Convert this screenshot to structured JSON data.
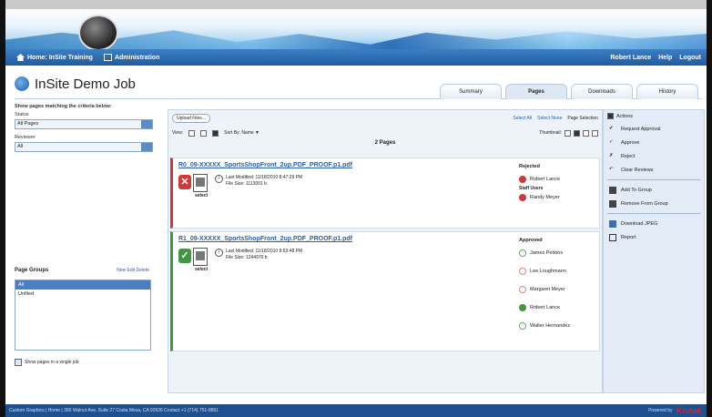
{
  "navbar": {
    "home": "Home: InSite Training",
    "admin": "Administration",
    "user_links": [
      "Robert Lance",
      "Help",
      "Logout"
    ]
  },
  "job": {
    "title": "InSite Demo Job"
  },
  "tabs": [
    {
      "label": "Summary",
      "active": false
    },
    {
      "label": "Pages",
      "active": true
    },
    {
      "label": "Downloads",
      "active": false
    },
    {
      "label": "History",
      "active": false
    }
  ],
  "filter": {
    "heading": "Show pages matching the criteria below:",
    "status_label": "Status",
    "status_value": "All Pages",
    "reviewer_label": "Reviewer",
    "reviewer_value": "All"
  },
  "page_groups": {
    "title": "Page Groups",
    "links": "New Edit Delete",
    "items": [
      {
        "label": "All",
        "selected": true
      },
      {
        "label": "Unfiled",
        "selected": false
      }
    ],
    "show_single": "Show pages in a single job"
  },
  "toolbar": {
    "upload": "Upload Files...",
    "select_all": "Select All",
    "select_none": "Select None",
    "page_selection": "Page Selection",
    "view_label": "View:",
    "sort_label": "Sort By: Name ▼",
    "thumbnail_label": "Thumbnail:"
  },
  "count": "2 Pages",
  "pages": [
    {
      "filename": "R0_09-XXXXX_SportsShopFront_2up.PDF_PROOF.p1.pdf",
      "status": "rejected",
      "status_glyph": "✕",
      "selected_label": "select",
      "last_modified": "Last Modified: 11/18/2010 8:47:29 PM",
      "file_size": "File Size: 1113001 b",
      "status_heading": "Rejected",
      "reviewers": [
        {
          "name": "Robert Lance",
          "state": "rejected"
        },
        {
          "group": "Staff Users"
        },
        {
          "name": "Randy Meyer",
          "state": "rejected"
        }
      ]
    },
    {
      "filename": "R1_09-XXXXX_SportsShopFront_2up.PDF_PROOF.p1.pdf",
      "status": "approved",
      "status_glyph": "✓",
      "selected_label": "select",
      "last_modified": "Last Modified: 11/18/2010 8:53:48 PM",
      "file_size": "File Size: 1244970 b",
      "status_heading": "Approved",
      "reviewers": [
        {
          "name": "James Perkins",
          "state": "pending-approve"
        },
        {
          "name": "Lee Loughmann",
          "state": "pending-reject"
        },
        {
          "name": "Margaret Meyer",
          "state": "pending-reject"
        },
        {
          "name": "Robert Lance",
          "state": "approved"
        },
        {
          "name": "Walter Hernandez",
          "state": "pending-approve"
        }
      ]
    }
  ],
  "actions": {
    "header": "Actions",
    "items": [
      "Request Approval",
      "Approve",
      "Reject",
      "Clear Reviews",
      "Add To Group",
      "Remove From Group",
      "Download JPEG",
      "Report"
    ]
  },
  "footer": {
    "text": "Custom Graphics | Home | 350 Walnut Ave, Suite 27 Costa Mesa, CA 92626 Contact +1 (714) 751-8861",
    "powered": "Powered by",
    "brand": "Kodak"
  },
  "colors": {
    "nav": "#1f5ca3",
    "rejected": "#d23838",
    "approved": "#3c9a3c",
    "link": "#2a5fa8"
  }
}
